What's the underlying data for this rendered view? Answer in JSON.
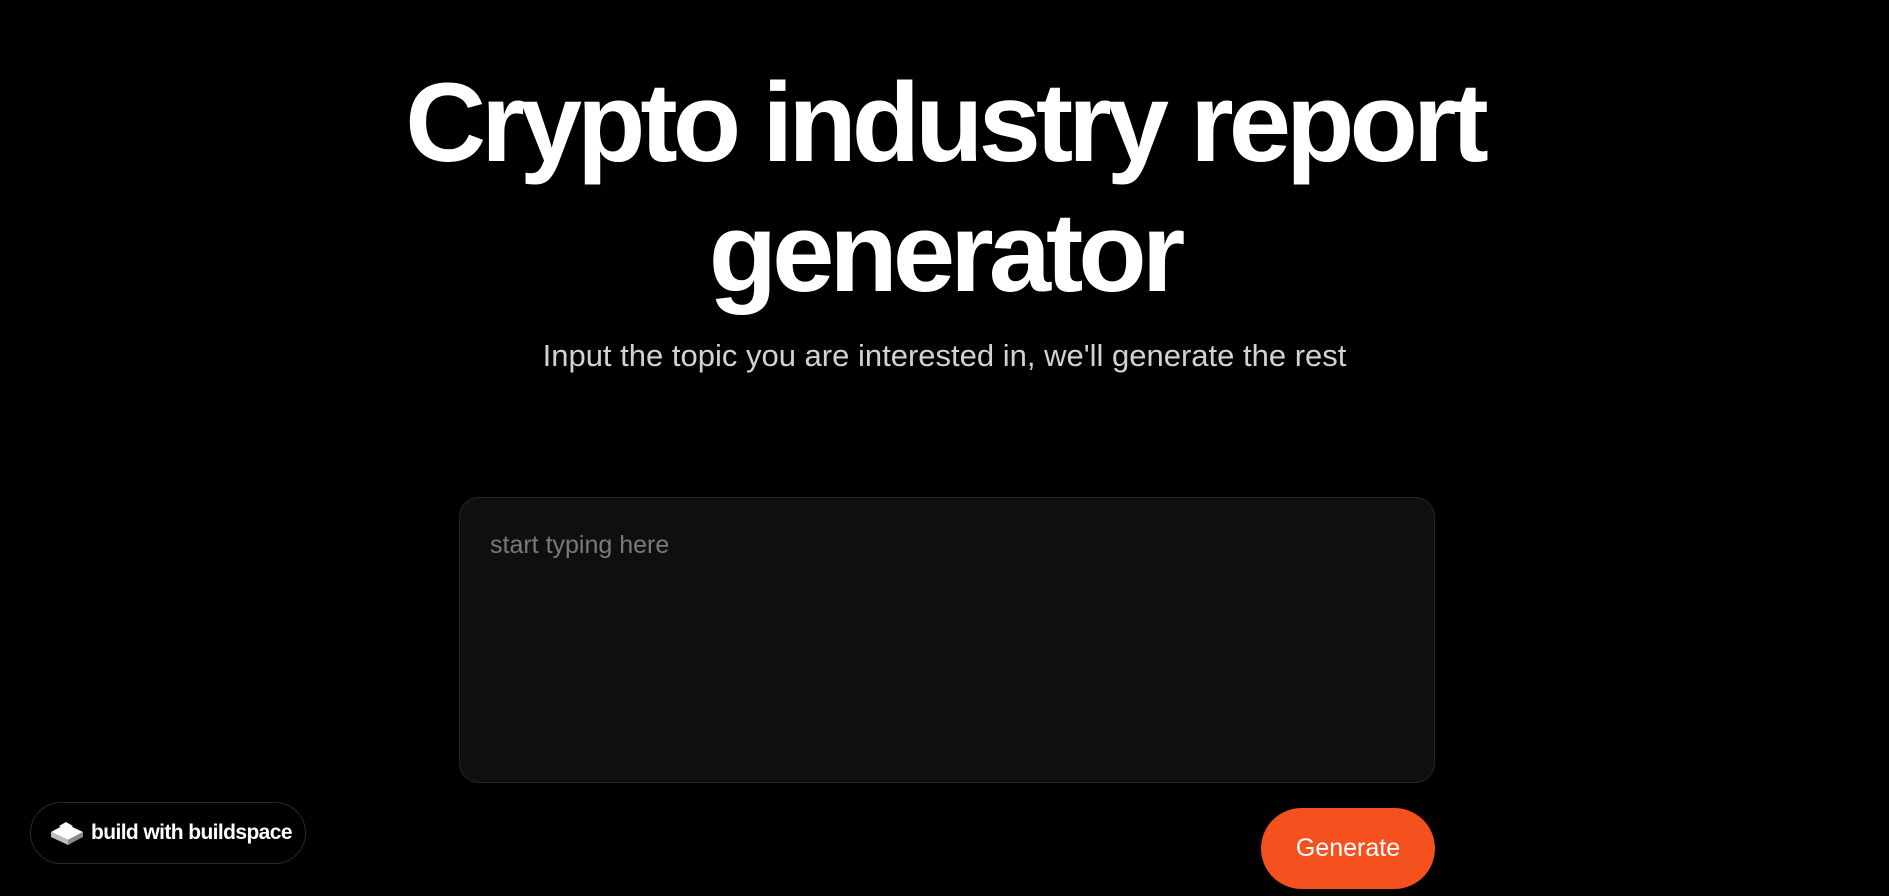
{
  "header": {
    "title_line1": "Crypto industry report",
    "title_line2": "generator",
    "subtitle": "Input the topic you are interested in, we'll generate the rest"
  },
  "prompt": {
    "placeholder": "start typing here",
    "value": ""
  },
  "actions": {
    "generate_label": "Generate"
  },
  "badge": {
    "label": "build with buildspace",
    "icon": "buildspace-logo-icon"
  },
  "colors": {
    "background": "#000000",
    "accent": "#f4511e",
    "input_background": "#0f0f0f"
  }
}
